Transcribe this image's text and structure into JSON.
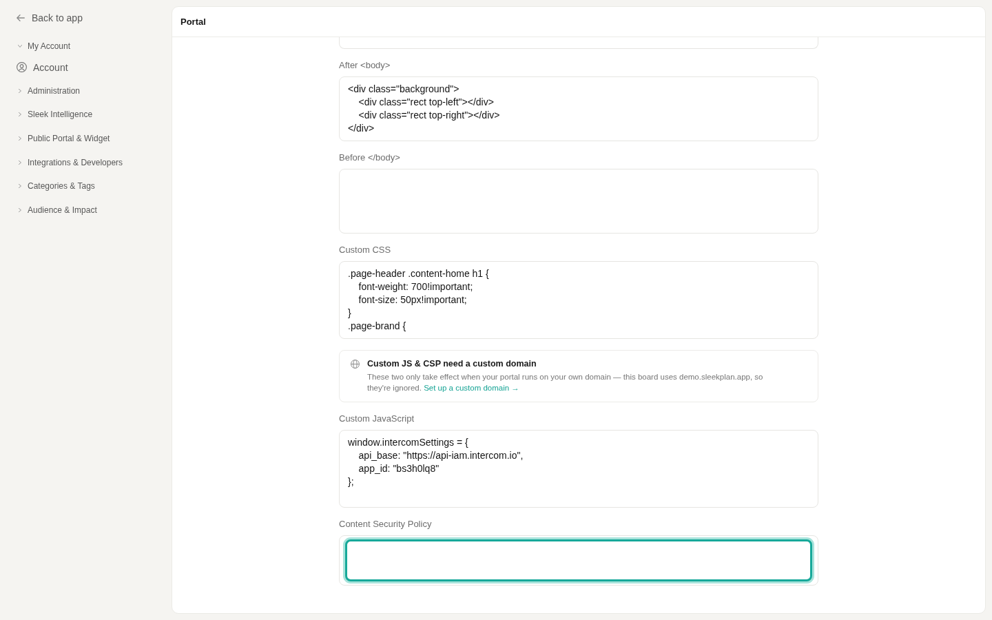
{
  "back_link": {
    "label": "Back to app"
  },
  "sidebar": {
    "groups": [
      {
        "label": "My Account",
        "expanded": true,
        "items": [
          {
            "label": "Account",
            "selected": false
          }
        ]
      },
      {
        "label": "Administration",
        "expanded": false
      },
      {
        "label": "Sleek Intelligence",
        "expanded": false
      },
      {
        "label": "Public Portal & Widget",
        "expanded": false
      },
      {
        "label": "Integrations & Developers",
        "expanded": false
      },
      {
        "label": "Categories & Tags",
        "expanded": false
      },
      {
        "label": "Audience & Impact",
        "expanded": false
      }
    ]
  },
  "page": {
    "title": "Portal"
  },
  "sections": [
    {
      "kind": "cut_field",
      "focused": false
    },
    {
      "kind": "field",
      "label": "After <body>",
      "value": "<div class=\"background\">\n    <div class=\"rect top-left\"></div>\n    <div class=\"rect top-right\"></div>\n</div>",
      "focused": false
    },
    {
      "kind": "field",
      "label": "Before </body>",
      "focused": false
    },
    {
      "kind": "field",
      "label": "Custom CSS",
      "value": ".page-header .content-home h1 {\n    font-weight: 700!important;\n    font-size: 50px!important;\n}\n.page-brand {",
      "focused": false
    },
    {
      "kind": "notice",
      "title": "Custom JS & CSP need a custom domain",
      "text": "These two only take effect when your portal runs on your own domain — this board uses demo.sleekplan.app, so they're ignored.",
      "link": "Set up a custom domain →"
    },
    {
      "kind": "field",
      "label": "Custom JavaScript",
      "value": "window.intercomSettings = {\n    api_base: \"https://api-iam.intercom.io\",\n    app_id: \"bs3h0lq8\"\n};\n",
      "focused": false
    },
    {
      "kind": "field",
      "label": "Content Security Policy",
      "focused": true
    }
  ]
}
